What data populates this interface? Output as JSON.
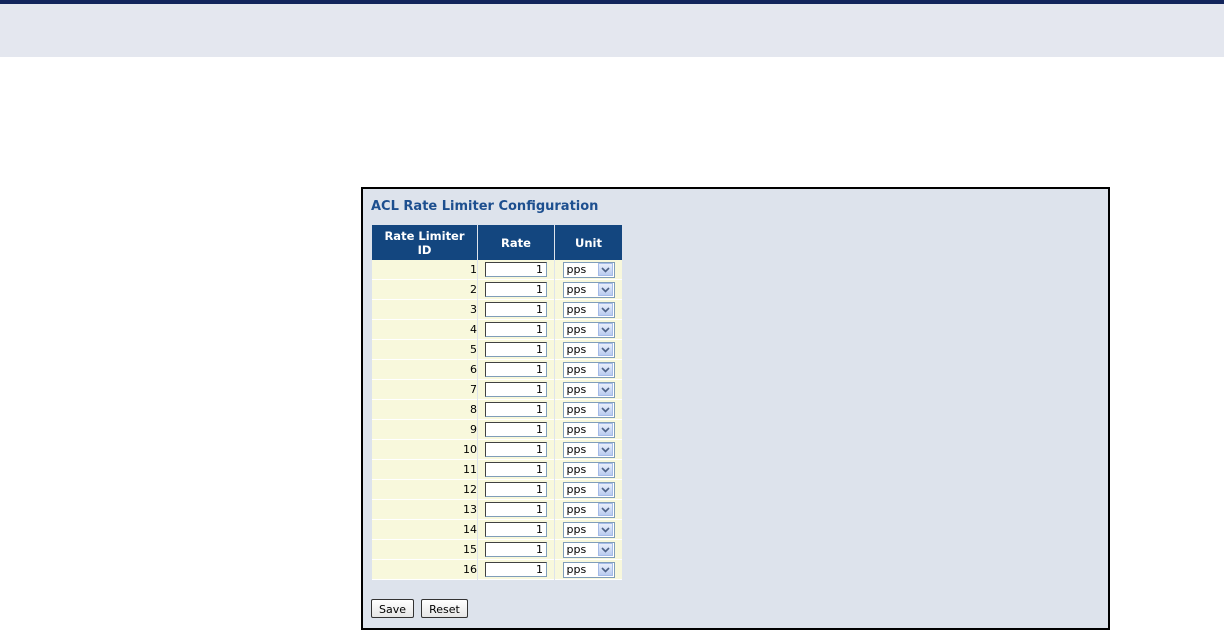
{
  "panel": {
    "title": "ACL Rate Limiter Configuration"
  },
  "table": {
    "headers": [
      "Rate Limiter ID",
      "Rate",
      "Unit"
    ],
    "rows": [
      {
        "id": "1",
        "rate": "1",
        "unit": "pps"
      },
      {
        "id": "2",
        "rate": "1",
        "unit": "pps"
      },
      {
        "id": "3",
        "rate": "1",
        "unit": "pps"
      },
      {
        "id": "4",
        "rate": "1",
        "unit": "pps"
      },
      {
        "id": "5",
        "rate": "1",
        "unit": "pps"
      },
      {
        "id": "6",
        "rate": "1",
        "unit": "pps"
      },
      {
        "id": "7",
        "rate": "1",
        "unit": "pps"
      },
      {
        "id": "8",
        "rate": "1",
        "unit": "pps"
      },
      {
        "id": "9",
        "rate": "1",
        "unit": "pps"
      },
      {
        "id": "10",
        "rate": "1",
        "unit": "pps"
      },
      {
        "id": "11",
        "rate": "1",
        "unit": "pps"
      },
      {
        "id": "12",
        "rate": "1",
        "unit": "pps"
      },
      {
        "id": "13",
        "rate": "1",
        "unit": "pps"
      },
      {
        "id": "14",
        "rate": "1",
        "unit": "pps"
      },
      {
        "id": "15",
        "rate": "1",
        "unit": "pps"
      },
      {
        "id": "16",
        "rate": "1",
        "unit": "pps"
      }
    ]
  },
  "buttons": {
    "save_label": "Save",
    "reset_label": "Reset"
  },
  "icons": {
    "dropdown": "chevron-down-icon"
  },
  "colors": {
    "header_bg": "#13467f",
    "title_text": "#1d4f8f",
    "row_bg": "#f8f8dc",
    "panel_bg": "#dde3ec",
    "top_band": "#e4e7ef",
    "top_rule": "#12255c"
  }
}
